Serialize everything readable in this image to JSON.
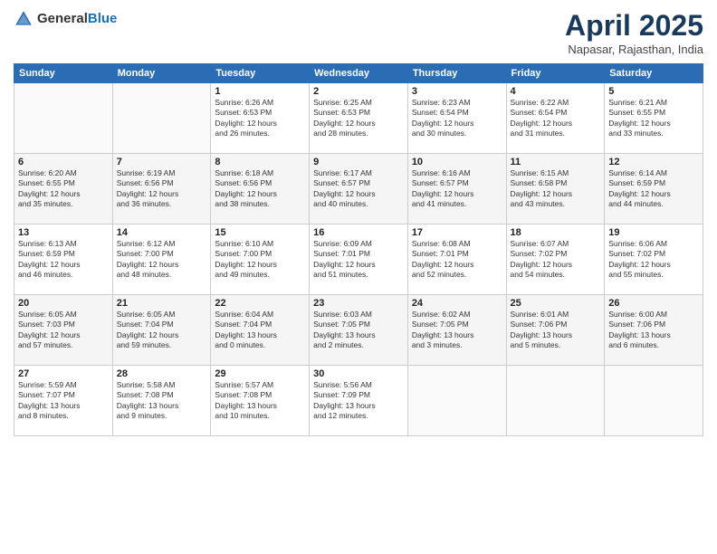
{
  "header": {
    "logo_general": "General",
    "logo_blue": "Blue",
    "title": "April 2025",
    "location": "Napasar, Rajasthan, India"
  },
  "weekdays": [
    "Sunday",
    "Monday",
    "Tuesday",
    "Wednesday",
    "Thursday",
    "Friday",
    "Saturday"
  ],
  "weeks": [
    [
      {
        "day": "",
        "info": ""
      },
      {
        "day": "",
        "info": ""
      },
      {
        "day": "1",
        "info": "Sunrise: 6:26 AM\nSunset: 6:53 PM\nDaylight: 12 hours\nand 26 minutes."
      },
      {
        "day": "2",
        "info": "Sunrise: 6:25 AM\nSunset: 6:53 PM\nDaylight: 12 hours\nand 28 minutes."
      },
      {
        "day": "3",
        "info": "Sunrise: 6:23 AM\nSunset: 6:54 PM\nDaylight: 12 hours\nand 30 minutes."
      },
      {
        "day": "4",
        "info": "Sunrise: 6:22 AM\nSunset: 6:54 PM\nDaylight: 12 hours\nand 31 minutes."
      },
      {
        "day": "5",
        "info": "Sunrise: 6:21 AM\nSunset: 6:55 PM\nDaylight: 12 hours\nand 33 minutes."
      }
    ],
    [
      {
        "day": "6",
        "info": "Sunrise: 6:20 AM\nSunset: 6:55 PM\nDaylight: 12 hours\nand 35 minutes."
      },
      {
        "day": "7",
        "info": "Sunrise: 6:19 AM\nSunset: 6:56 PM\nDaylight: 12 hours\nand 36 minutes."
      },
      {
        "day": "8",
        "info": "Sunrise: 6:18 AM\nSunset: 6:56 PM\nDaylight: 12 hours\nand 38 minutes."
      },
      {
        "day": "9",
        "info": "Sunrise: 6:17 AM\nSunset: 6:57 PM\nDaylight: 12 hours\nand 40 minutes."
      },
      {
        "day": "10",
        "info": "Sunrise: 6:16 AM\nSunset: 6:57 PM\nDaylight: 12 hours\nand 41 minutes."
      },
      {
        "day": "11",
        "info": "Sunrise: 6:15 AM\nSunset: 6:58 PM\nDaylight: 12 hours\nand 43 minutes."
      },
      {
        "day": "12",
        "info": "Sunrise: 6:14 AM\nSunset: 6:59 PM\nDaylight: 12 hours\nand 44 minutes."
      }
    ],
    [
      {
        "day": "13",
        "info": "Sunrise: 6:13 AM\nSunset: 6:59 PM\nDaylight: 12 hours\nand 46 minutes."
      },
      {
        "day": "14",
        "info": "Sunrise: 6:12 AM\nSunset: 7:00 PM\nDaylight: 12 hours\nand 48 minutes."
      },
      {
        "day": "15",
        "info": "Sunrise: 6:10 AM\nSunset: 7:00 PM\nDaylight: 12 hours\nand 49 minutes."
      },
      {
        "day": "16",
        "info": "Sunrise: 6:09 AM\nSunset: 7:01 PM\nDaylight: 12 hours\nand 51 minutes."
      },
      {
        "day": "17",
        "info": "Sunrise: 6:08 AM\nSunset: 7:01 PM\nDaylight: 12 hours\nand 52 minutes."
      },
      {
        "day": "18",
        "info": "Sunrise: 6:07 AM\nSunset: 7:02 PM\nDaylight: 12 hours\nand 54 minutes."
      },
      {
        "day": "19",
        "info": "Sunrise: 6:06 AM\nSunset: 7:02 PM\nDaylight: 12 hours\nand 55 minutes."
      }
    ],
    [
      {
        "day": "20",
        "info": "Sunrise: 6:05 AM\nSunset: 7:03 PM\nDaylight: 12 hours\nand 57 minutes."
      },
      {
        "day": "21",
        "info": "Sunrise: 6:05 AM\nSunset: 7:04 PM\nDaylight: 12 hours\nand 59 minutes."
      },
      {
        "day": "22",
        "info": "Sunrise: 6:04 AM\nSunset: 7:04 PM\nDaylight: 13 hours\nand 0 minutes."
      },
      {
        "day": "23",
        "info": "Sunrise: 6:03 AM\nSunset: 7:05 PM\nDaylight: 13 hours\nand 2 minutes."
      },
      {
        "day": "24",
        "info": "Sunrise: 6:02 AM\nSunset: 7:05 PM\nDaylight: 13 hours\nand 3 minutes."
      },
      {
        "day": "25",
        "info": "Sunrise: 6:01 AM\nSunset: 7:06 PM\nDaylight: 13 hours\nand 5 minutes."
      },
      {
        "day": "26",
        "info": "Sunrise: 6:00 AM\nSunset: 7:06 PM\nDaylight: 13 hours\nand 6 minutes."
      }
    ],
    [
      {
        "day": "27",
        "info": "Sunrise: 5:59 AM\nSunset: 7:07 PM\nDaylight: 13 hours\nand 8 minutes."
      },
      {
        "day": "28",
        "info": "Sunrise: 5:58 AM\nSunset: 7:08 PM\nDaylight: 13 hours\nand 9 minutes."
      },
      {
        "day": "29",
        "info": "Sunrise: 5:57 AM\nSunset: 7:08 PM\nDaylight: 13 hours\nand 10 minutes."
      },
      {
        "day": "30",
        "info": "Sunrise: 5:56 AM\nSunset: 7:09 PM\nDaylight: 13 hours\nand 12 minutes."
      },
      {
        "day": "",
        "info": ""
      },
      {
        "day": "",
        "info": ""
      },
      {
        "day": "",
        "info": ""
      }
    ]
  ]
}
